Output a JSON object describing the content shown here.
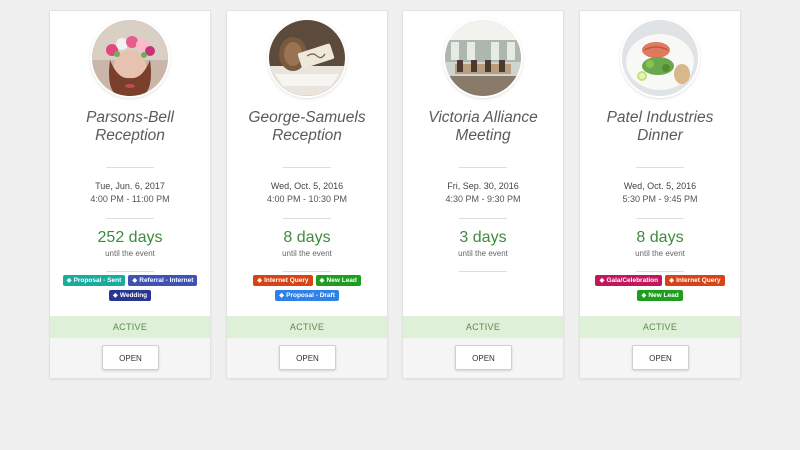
{
  "cards": [
    {
      "photo": "flower-crown-portrait",
      "title_line1": "Parsons-Bell",
      "title_line2": "Reception",
      "date": "Tue, Jun. 6, 2017",
      "time": "4:00 PM - 11:00 PM",
      "days": "252 days",
      "until": "until the event",
      "tags": [
        {
          "label": "Proposal - Sent",
          "color": "#1aab9f"
        },
        {
          "label": "Referral - Internet",
          "color": "#3f51b5"
        },
        {
          "label": "Wedding",
          "color": "#283593"
        }
      ],
      "status": "ACTIVE",
      "open_label": "OPEN"
    },
    {
      "photo": "place-card-table-setting",
      "title_line1": "George-Samuels",
      "title_line2": "Reception",
      "date": "Wed, Oct. 5, 2016",
      "time": "4:00 PM - 10:30 PM",
      "days": "8 days",
      "until": "until the event",
      "tags": [
        {
          "label": "Internet Query",
          "color": "#d84315"
        },
        {
          "label": "New Lead",
          "color": "#1e9e1e"
        },
        {
          "label": "Proposal - Draft",
          "color": "#2f80e8"
        }
      ],
      "status": "ACTIVE",
      "open_label": "OPEN"
    },
    {
      "photo": "conference-room",
      "title_line1": "Victoria Alliance",
      "title_line2": "Meeting",
      "date": "Fri, Sep. 30, 2016",
      "time": "4:30 PM - 9:30 PM",
      "days": "3 days",
      "until": "until the event",
      "tags": [],
      "status": "ACTIVE",
      "open_label": "OPEN"
    },
    {
      "photo": "salmon-dinner-plate",
      "title_line1": "Patel Industries",
      "title_line2": "Dinner",
      "date": "Wed, Oct. 5, 2016",
      "time": "5:30 PM - 9:45 PM",
      "days": "8 days",
      "until": "until the event",
      "tags": [
        {
          "label": "Gala/Celebration",
          "color": "#c2185b"
        },
        {
          "label": "Internet Query",
          "color": "#d84315"
        },
        {
          "label": "New Lead",
          "color": "#1e9e1e"
        }
      ],
      "status": "ACTIVE",
      "open_label": "OPEN"
    }
  ]
}
